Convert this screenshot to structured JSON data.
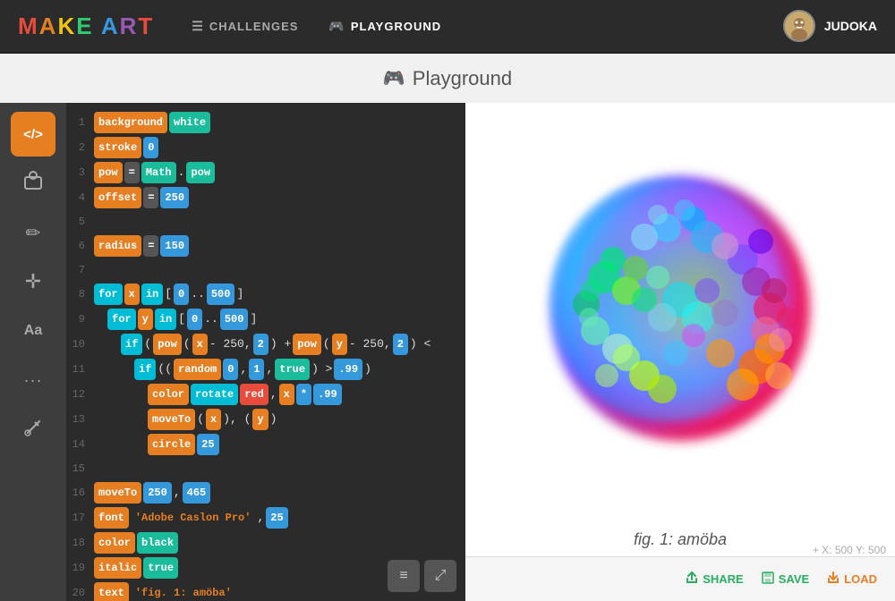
{
  "header": {
    "logo": "MAKE ART",
    "nav": [
      {
        "id": "challenges",
        "label": "CHALLENGES",
        "icon": "☰",
        "active": false
      },
      {
        "id": "playground",
        "label": "PLAYGROUND",
        "icon": "🎮",
        "active": true
      }
    ],
    "user": {
      "name": "JUDOKA"
    }
  },
  "subheader": {
    "icon": "🎮",
    "title": "Playground"
  },
  "sidebar": {
    "tools": [
      {
        "id": "code",
        "icon": "</>",
        "active": true
      },
      {
        "id": "shapes",
        "icon": "⬛",
        "active": false
      },
      {
        "id": "pencil",
        "icon": "✏",
        "active": false
      },
      {
        "id": "move",
        "icon": "✛",
        "active": false
      },
      {
        "id": "text",
        "icon": "Aa",
        "active": false
      },
      {
        "id": "more",
        "icon": "···",
        "active": false
      },
      {
        "id": "eyedropper",
        "icon": "💉",
        "active": false
      }
    ]
  },
  "editor": {
    "lines": [
      {
        "num": 1,
        "content": "background white"
      },
      {
        "num": 2,
        "content": "stroke 0"
      },
      {
        "num": 3,
        "content": "pow = Math.pow"
      },
      {
        "num": 4,
        "content": "offset = 250"
      },
      {
        "num": 5,
        "content": ""
      },
      {
        "num": 6,
        "content": "radius = 150"
      },
      {
        "num": 7,
        "content": ""
      },
      {
        "num": 8,
        "content": "for x in [0 .. 500]"
      },
      {
        "num": 9,
        "content": "  for y in [0 .. 500]"
      },
      {
        "num": 10,
        "content": "    if (pow(x - 250, 2) + pow(y - 250, 2) <"
      },
      {
        "num": 11,
        "content": "      if ((random 0, 1, true) > .99)"
      },
      {
        "num": 12,
        "content": "        color rotate red, x* .99"
      },
      {
        "num": 13,
        "content": "        moveTo (x), (y)"
      },
      {
        "num": 14,
        "content": "        circle 25"
      },
      {
        "num": 15,
        "content": ""
      },
      {
        "num": 16,
        "content": "moveTo 250, 465"
      },
      {
        "num": 17,
        "content": "font 'Adobe Caslon Pro', 25"
      },
      {
        "num": 18,
        "content": "color black"
      },
      {
        "num": 19,
        "content": "italic true"
      },
      {
        "num": 20,
        "content": "text 'fig. 1: amöba'"
      }
    ]
  },
  "editor_toolbar": {
    "format_btn": "≡",
    "expand_btn": "⤢"
  },
  "preview": {
    "caption": "fig. 1: amöba",
    "coords": "+ X: 500 Y: 500",
    "actions": [
      {
        "id": "share",
        "icon": "↑",
        "label": "SHARE"
      },
      {
        "id": "save",
        "icon": "💾",
        "label": "SAVE"
      },
      {
        "id": "load",
        "icon": "↑",
        "label": "LOAD"
      }
    ]
  }
}
